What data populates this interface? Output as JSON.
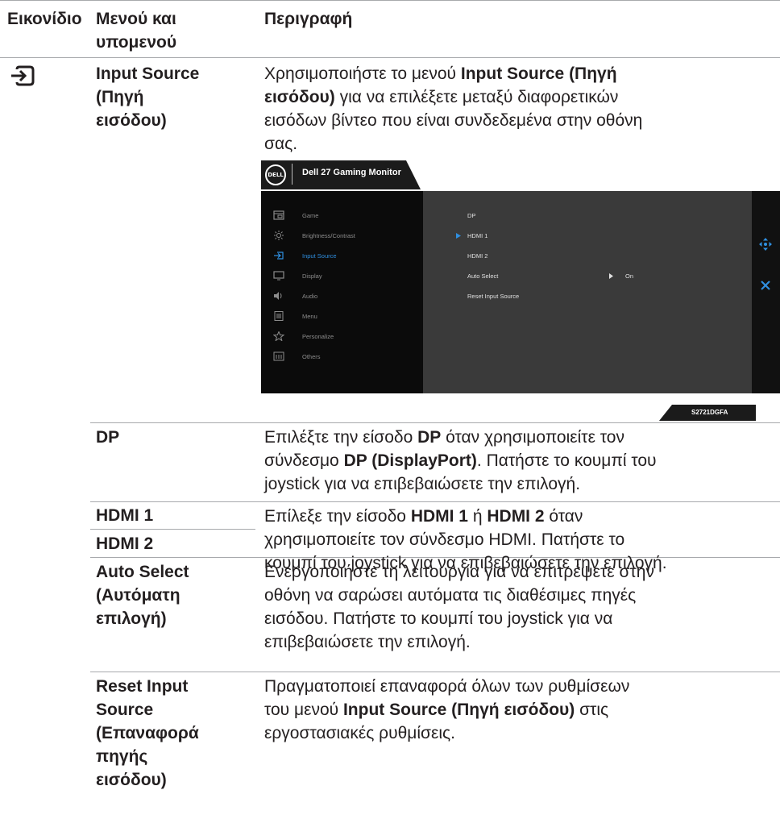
{
  "header": {
    "col1": "Εικονίδιο",
    "col2_line1": "Μενού και",
    "col2_line2": "υπομενού",
    "col3": "Περιγραφή"
  },
  "input_source": {
    "icon": "input-source-icon",
    "term_lines": [
      "Input Source",
      "(Πηγή",
      "εισόδου)"
    ],
    "desc_lines": [
      [
        "Χρησιμοποιήστε το μενού ",
        "Input Source (Πηγή"
      ],
      [
        "εισόδου)",
        " για να επιλέξετε μεταξύ διαφορετικών"
      ],
      [
        "εισόδων βίντεο που είναι συνδεδεμένα στην οθόνη"
      ],
      [
        "σας."
      ]
    ]
  },
  "osd": {
    "brand": "DELL",
    "title": "Dell 27 Gaming Monitor",
    "menu_items": [
      {
        "label": "Game",
        "icon": "game-icon"
      },
      {
        "label": "Brightness/Contrast",
        "icon": "brightness-icon"
      },
      {
        "label": "Input Source",
        "icon": "input-source-icon"
      },
      {
        "label": "Display",
        "icon": "display-icon"
      },
      {
        "label": "Audio",
        "icon": "audio-icon"
      },
      {
        "label": "Menu",
        "icon": "menu-icon"
      },
      {
        "label": "Personalize",
        "icon": "star-icon"
      },
      {
        "label": "Others",
        "icon": "others-icon"
      }
    ],
    "active_item": "Input Source",
    "sub_items": [
      "DP",
      "HDMI 1",
      "HDMI 2",
      "Auto Select",
      "Reset Input Source"
    ],
    "selected_sub": "HDMI 1",
    "auto_select_value": "On",
    "model": "S2721DGFA",
    "colors": {
      "active": "#2f8fe0",
      "panel": "#3a3a3a",
      "sidebar": "#0b0b0b"
    }
  },
  "rows": {
    "dp": {
      "term": "DP",
      "l1": [
        "Επιλέξτε την είσοδο ",
        "DP",
        " όταν χρησιμοποιείτε τον"
      ],
      "l2": [
        "σύνδεσμο ",
        "DP (DisplayPort)",
        ". Πατήστε το κουμπί του"
      ],
      "l3": "joystick για να επιβεβαιώσετε την επιλογή."
    },
    "hdmi": {
      "term1": "HDMI 1",
      "term2": "HDMI 2",
      "l1": [
        "Επίλεξε την είσοδο ",
        "HDMI 1",
        " ή ",
        "HDMI 2",
        " όταν"
      ],
      "l2": "χρησιμοποιείτε τον σύνδεσμο HDMI. Πατήστε το",
      "l3": "κουμπί του joystick για να επιβεβαιώσετε την επιλογή."
    },
    "auto": {
      "term_lines": [
        "Auto Select",
        "(Αυτόματη",
        "επιλογή)"
      ],
      "desc_lines": [
        "Ενεργοποιήστε τη λειτουργία για να επιτρέψετε στην",
        "οθόνη να σαρώσει αυτόματα τις διαθέσιμες πηγές",
        "εισόδου. Πατήστε το κουμπί του joystick για να",
        "επιβεβαιώσετε την επιλογή."
      ]
    },
    "reset": {
      "term_lines": [
        "Reset Input",
        "Source",
        "(Επαναφορά",
        "πηγής",
        "εισόδου)"
      ],
      "l1": "Πραγματοποιεί επαναφορά όλων των ρυθμίσεων",
      "l2": [
        "του μενού ",
        "Input Source (Πηγή εισόδου)",
        " στις"
      ],
      "l3": "εργοστασιακές ρυθμίσεις."
    }
  }
}
